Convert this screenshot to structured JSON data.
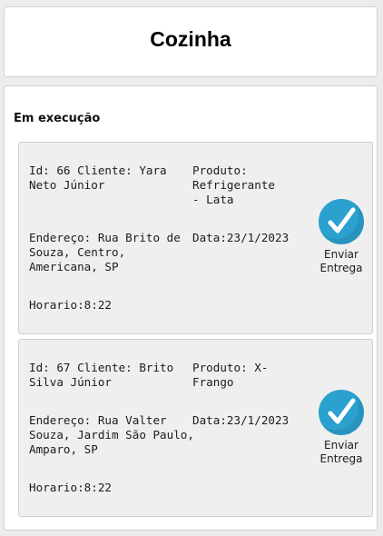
{
  "header": {
    "title": "Cozinha"
  },
  "section": {
    "heading": "Em execução"
  },
  "orders": [
    {
      "id_cliente": "Id: 66 Cliente: Yara Neto Júnior",
      "produto": "Produto: Refrigerante - Lata",
      "endereco": "Endereço: Rua Brito de Souza, Centro, Americana, SP",
      "data": "Data:23/1/2023",
      "horario": "Horario:8:22",
      "button_label": "Enviar Entrega"
    },
    {
      "id_cliente": "Id: 67 Cliente: Brito Silva Júnior",
      "produto": "Produto: X-Frango",
      "endereco": "Endereço: Rua Valter Souza, Jardim São Paulo, Amparo, SP",
      "data": "Data:23/1/2023",
      "horario": "Horario:8:22",
      "button_label": "Enviar Entrega"
    }
  ],
  "colors": {
    "page_bg": "#ececec",
    "card_bg": "#ffffff",
    "order_bg": "#efefef",
    "accent_check": "#2aa1cf"
  },
  "icons": {
    "send_icon": "checkmark-circle-icon"
  }
}
